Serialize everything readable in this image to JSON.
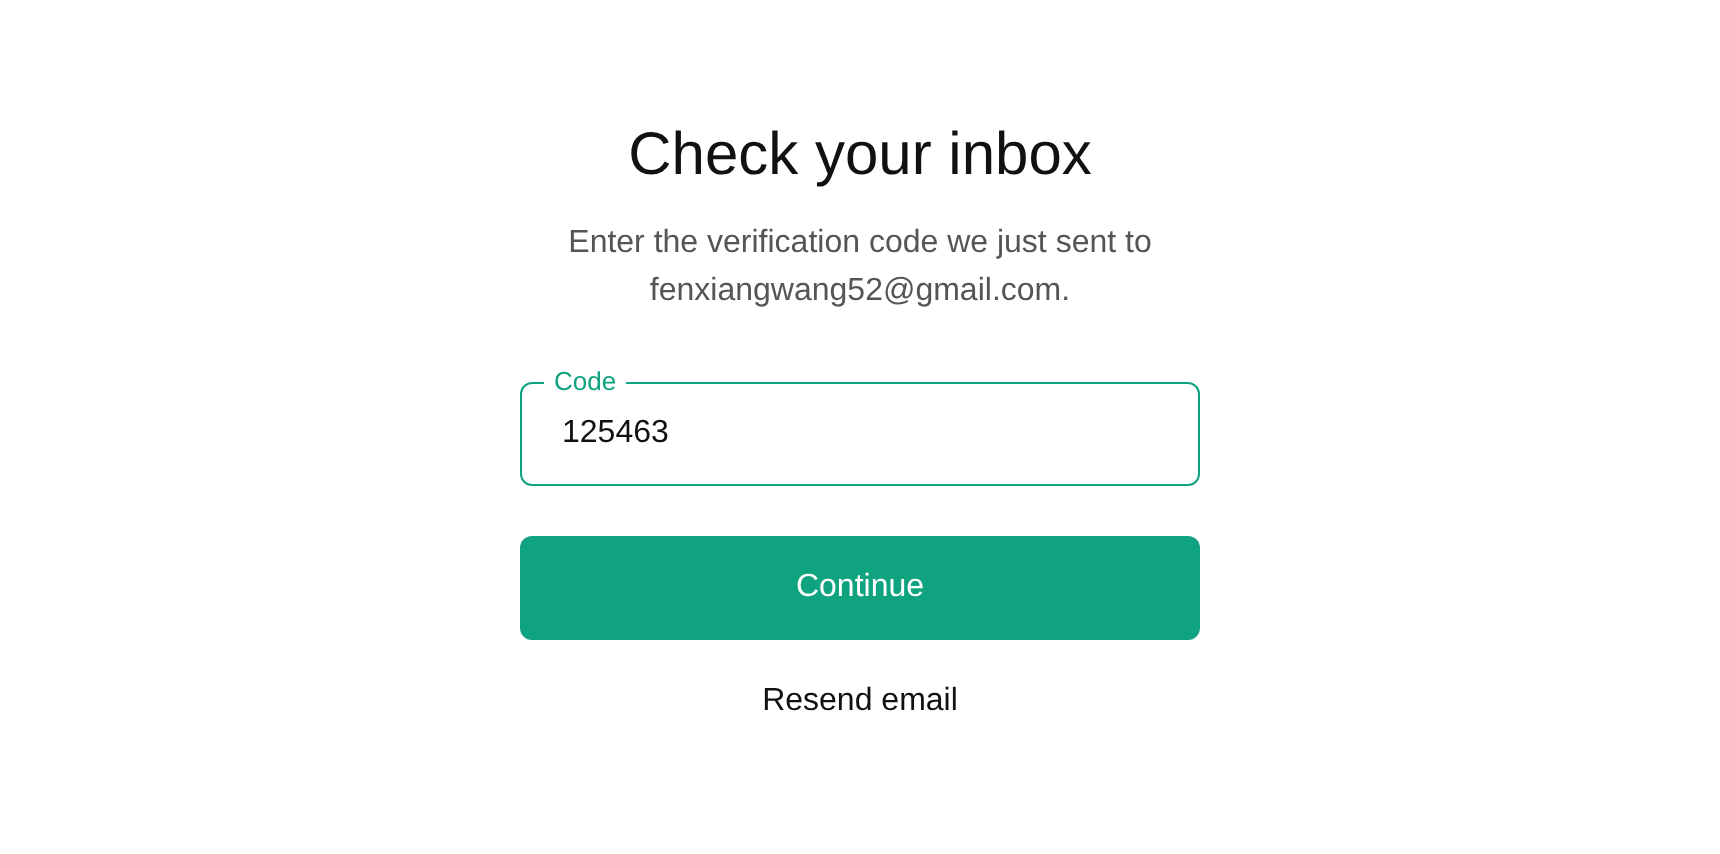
{
  "title": "Check your inbox",
  "message": "Enter the verification code we just sent to fenxiangwang52@gmail.com.",
  "field": {
    "label": "Code",
    "value": "125463"
  },
  "button": {
    "label": "Continue"
  },
  "link": {
    "label": "Resend email"
  }
}
